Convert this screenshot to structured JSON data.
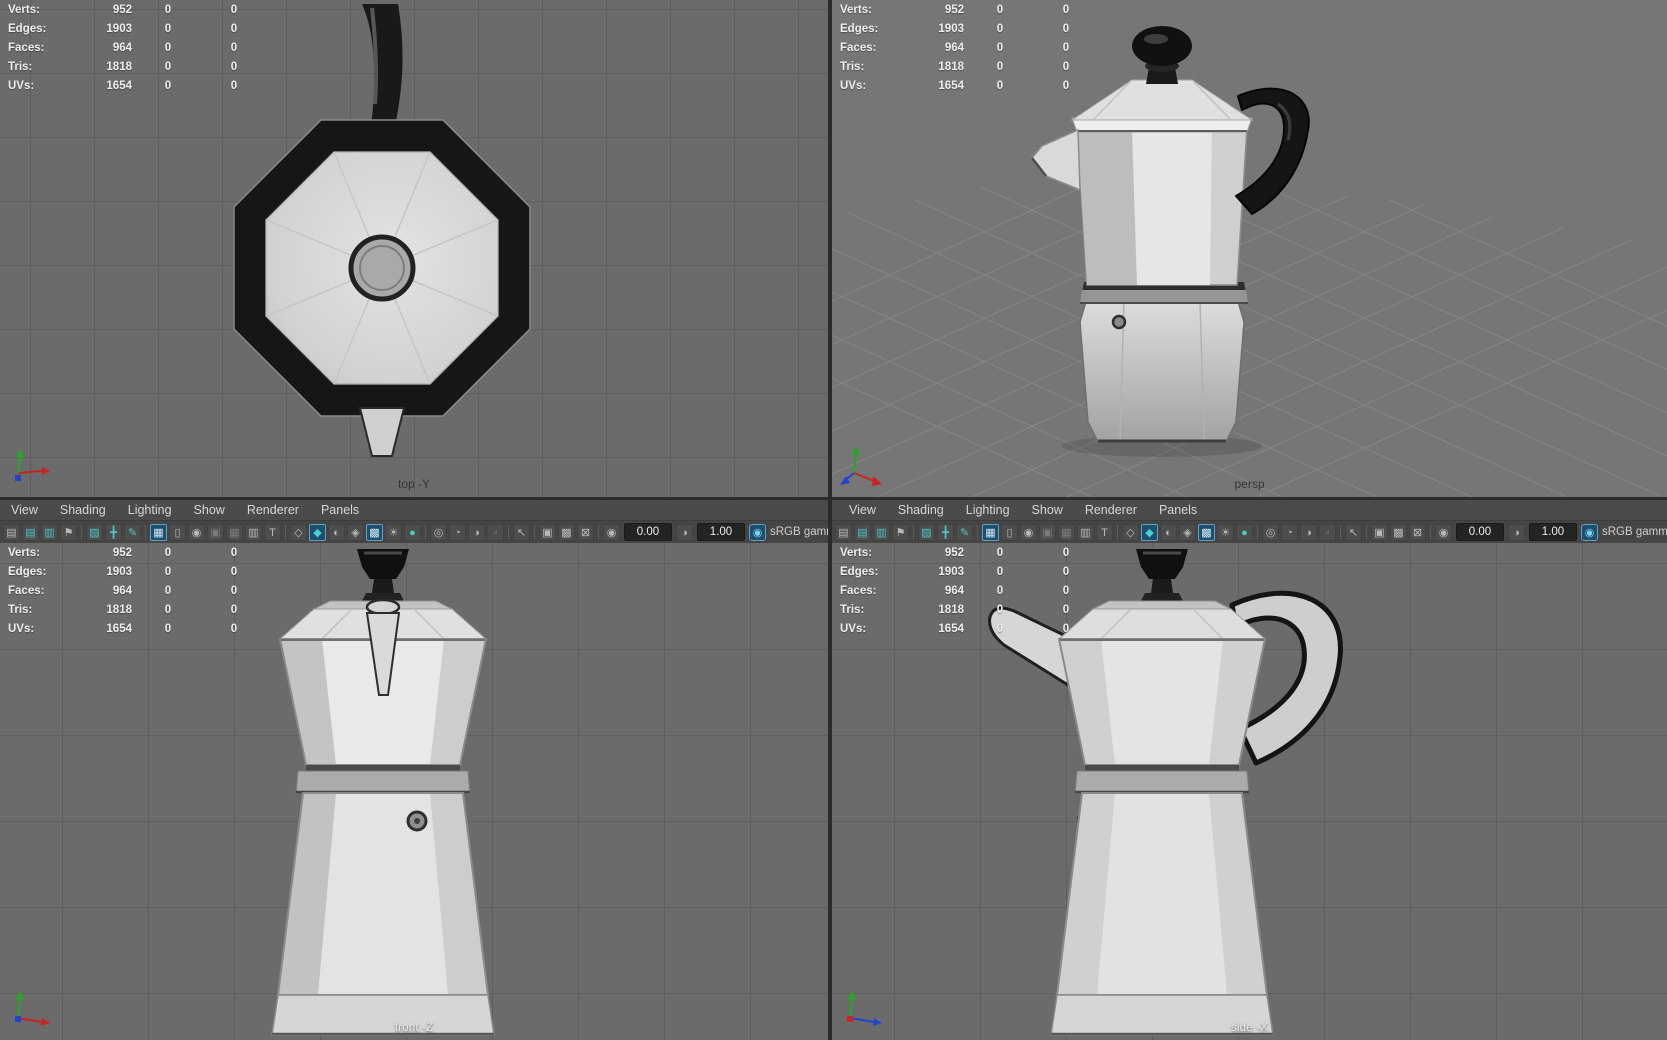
{
  "hud": {
    "rows": [
      {
        "label": "Verts:",
        "v1": "952",
        "v2": "0",
        "v3": "0"
      },
      {
        "label": "Edges:",
        "v1": "1903",
        "v2": "0",
        "v3": "0"
      },
      {
        "label": "Faces:",
        "v1": "964",
        "v2": "0",
        "v3": "0"
      },
      {
        "label": "Tris:",
        "v1": "1818",
        "v2": "0",
        "v3": "0"
      },
      {
        "label": "UVs:",
        "v1": "1654",
        "v2": "0",
        "v3": "0"
      }
    ]
  },
  "menus": {
    "items": [
      {
        "label": "View",
        "name": "menu-view",
        "inter": true
      },
      {
        "label": "Shading",
        "name": "menu-shading",
        "inter": true
      },
      {
        "label": "Lighting",
        "name": "menu-lighting",
        "inter": true
      },
      {
        "label": "Show",
        "name": "menu-show",
        "inter": true
      },
      {
        "label": "Renderer",
        "name": "menu-renderer",
        "inter": true
      },
      {
        "label": "Panels",
        "name": "menu-panels",
        "inter": true
      }
    ]
  },
  "toolbar": {
    "items": [
      {
        "name": "select-camera-icon",
        "text": "▤",
        "cls": "icon",
        "inter": true
      },
      {
        "name": "lock-camera-icon",
        "text": "▤",
        "cls": "icon teal",
        "inter": true
      },
      {
        "name": "camera-attributes-icon",
        "text": "▥",
        "cls": "icon teal",
        "inter": true
      },
      {
        "name": "bookmark-icon",
        "text": "⚑",
        "cls": "icon",
        "inter": true
      },
      {
        "name": "toolbar-separator",
        "cls": "sep",
        "inter": false
      },
      {
        "name": "image-plane-icon",
        "text": "▨",
        "cls": "icon teal",
        "inter": true
      },
      {
        "name": "pan-zoom-icon",
        "text": "╋",
        "cls": "icon teal",
        "inter": true
      },
      {
        "name": "grease-pencil-icon",
        "text": "✎",
        "cls": "icon teal",
        "inter": true
      },
      {
        "name": "toolbar-separator",
        "cls": "sep",
        "inter": false
      },
      {
        "name": "grid-icon",
        "text": "▦",
        "cls": "icon active",
        "inter": true
      },
      {
        "name": "film-gate-icon",
        "text": "▯",
        "cls": "icon",
        "inter": true
      },
      {
        "name": "resolution-gate-icon",
        "text": "◉",
        "cls": "icon",
        "inter": true
      },
      {
        "name": "gate-mask-icon",
        "text": "▣",
        "cls": "icon dim",
        "inter": true
      },
      {
        "name": "field-chart-icon",
        "text": "▦",
        "cls": "icon dim",
        "inter": true
      },
      {
        "name": "safe-action-icon",
        "text": "▥",
        "cls": "icon",
        "inter": true
      },
      {
        "name": "safe-title-icon",
        "text": "T",
        "cls": "icon",
        "inter": true
      },
      {
        "name": "toolbar-separator",
        "cls": "sep",
        "inter": false
      },
      {
        "name": "wireframe-icon",
        "text": "◇",
        "cls": "icon",
        "inter": true
      },
      {
        "name": "smooth-shade-icon",
        "text": "◆",
        "cls": "icon active teal",
        "inter": true
      },
      {
        "name": "flat-shade-icon",
        "text": "◐",
        "cls": "icon",
        "inter": true
      },
      {
        "name": "bounding-box-icon",
        "text": "◈",
        "cls": "icon",
        "inter": true
      },
      {
        "name": "textured-icon",
        "text": "▩",
        "cls": "icon active",
        "inter": true
      },
      {
        "name": "use-all-lights-icon",
        "text": "☀",
        "cls": "icon",
        "inter": true
      },
      {
        "name": "shadows-icon",
        "text": "●",
        "cls": "icon teal",
        "inter": true
      },
      {
        "name": "toolbar-separator",
        "cls": "sep",
        "inter": false
      },
      {
        "name": "occlusion-icon",
        "text": "◎",
        "cls": "icon",
        "inter": true
      },
      {
        "name": "motion-blur-icon",
        "text": "◔",
        "cls": "icon",
        "inter": true
      },
      {
        "name": "multisample-icon",
        "text": "◑",
        "cls": "icon",
        "inter": true
      },
      {
        "name": "depth-peeling-icon",
        "text": "▫",
        "cls": "icon dim",
        "inter": true
      },
      {
        "name": "toolbar-separator",
        "cls": "sep",
        "inter": false
      },
      {
        "name": "isolate-select-icon",
        "text": "↖",
        "cls": "icon",
        "inter": true
      },
      {
        "name": "toolbar-separator",
        "cls": "sep",
        "inter": false
      },
      {
        "name": "xray-icon",
        "text": "▣",
        "cls": "icon",
        "inter": true
      },
      {
        "name": "wireframe-on-shaded-icon",
        "text": "▩",
        "cls": "icon",
        "inter": true
      },
      {
        "name": "xray-joints-icon",
        "text": "⊠",
        "cls": "icon",
        "inter": true
      },
      {
        "name": "toolbar-separator",
        "cls": "sep",
        "inter": false
      },
      {
        "name": "exposure-icon",
        "text": "◉",
        "cls": "icon",
        "inter": true
      },
      {
        "name": "exposure-field",
        "text": "0.00",
        "cls": "field",
        "inter": true
      },
      {
        "name": "contrast-icon",
        "text": "◑",
        "cls": "icon",
        "inter": true
      },
      {
        "name": "contrast-field",
        "text": "1.00",
        "cls": "field",
        "inter": true
      },
      {
        "name": "gamma-toggle-icon",
        "text": "◉",
        "cls": "icon gamma",
        "inter": true
      },
      {
        "name": "gamma-label",
        "text": "sRGB gamm",
        "cls": "label",
        "inter": false
      }
    ]
  },
  "viewports": {
    "top": {
      "label": "top -Y"
    },
    "persp": {
      "label": "persp"
    },
    "front": {
      "label": "front -Z"
    },
    "side": {
      "label": "side -X"
    }
  },
  "colors": {
    "active_button_blue": "#1f4f6e",
    "teal_icon": "#4cc6c6",
    "ortho_viewport_bg": "#6b6b6b",
    "persp_viewport_bg": "#767676",
    "menu_bg": "#4b4b4b"
  }
}
